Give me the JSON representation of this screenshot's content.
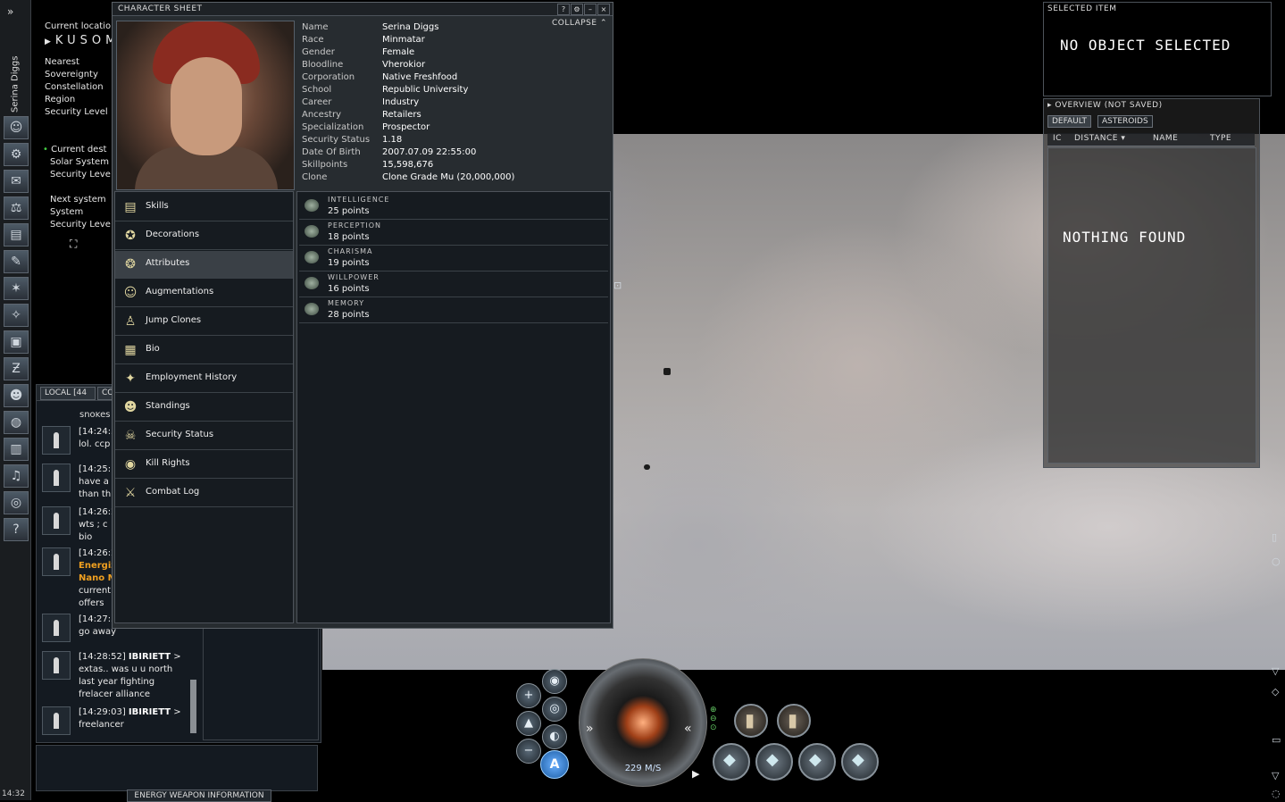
{
  "neocom": {
    "character_name": "Serina Diggs",
    "clock": "14:32",
    "expand_glyph": "»",
    "icons": [
      "portrait-icon",
      "assets-icon",
      "mail-icon",
      "market-icon",
      "wallet-icon",
      "journal-icon",
      "map-icon",
      "starmap-icon",
      "ship-icon",
      "scanner-icon",
      "people-icon",
      "world-icon",
      "notepad-icon",
      "audio-icon",
      "browser-icon",
      "help-icon"
    ]
  },
  "location": {
    "current_location_label": "Current locatio",
    "system_name": "KUSOM",
    "nearest_label": "Nearest",
    "sovereignty_label": "Sovereignty",
    "constellation_label": "Constellation",
    "region_label": "Region",
    "security_label": "Security Level",
    "current_dest_label": "Current dest",
    "solar_system_label": "Solar System",
    "security_label_2": "Security Leve",
    "next_system_label": "Next system",
    "system_label": "System",
    "security_label_3": "Security Leve"
  },
  "character_sheet": {
    "title": "CHARACTER SHEET",
    "collapse_label": "COLLAPSE",
    "controls": [
      "?",
      "⚙",
      "–",
      "×"
    ],
    "info": [
      {
        "key": "Name",
        "value": "Serina Diggs"
      },
      {
        "key": "Race",
        "value": "Minmatar"
      },
      {
        "key": "Gender",
        "value": "Female"
      },
      {
        "key": "Bloodline",
        "value": "Vherokior"
      },
      {
        "key": "Corporation",
        "value": "Native Freshfood"
      },
      {
        "key": "School",
        "value": "Republic University"
      },
      {
        "key": "Career",
        "value": "Industry"
      },
      {
        "key": "Ancestry",
        "value": "Retailers"
      },
      {
        "key": "Specialization",
        "value": "Prospector"
      },
      {
        "key": "Security Status",
        "value": "1.18"
      },
      {
        "key": "Date Of Birth",
        "value": "2007.07.09 22:55:00"
      },
      {
        "key": "Skillpoints",
        "value": "15,598,676"
      },
      {
        "key": "Clone",
        "value": "Clone Grade Mu (20,000,000)"
      }
    ],
    "nav": [
      {
        "label": "Skills",
        "icon": "book-icon"
      },
      {
        "label": "Decorations",
        "icon": "medal-icon"
      },
      {
        "label": "Attributes",
        "icon": "brain-icon",
        "selected": true
      },
      {
        "label": "Augmentations",
        "icon": "head-icon"
      },
      {
        "label": "Jump Clones",
        "icon": "clone-icon"
      },
      {
        "label": "Bio",
        "icon": "bio-icon"
      },
      {
        "label": "Employment History",
        "icon": "stars-icon"
      },
      {
        "label": "Standings",
        "icon": "people-icon"
      },
      {
        "label": "Security Status",
        "icon": "skull-icon"
      },
      {
        "label": "Kill Rights",
        "icon": "target-icon"
      },
      {
        "label": "Combat Log",
        "icon": "swords-icon"
      }
    ],
    "attributes": [
      {
        "name": "INTELLIGENCE",
        "points": "25 points"
      },
      {
        "name": "PERCEPTION",
        "points": "18 points"
      },
      {
        "name": "CHARISMA",
        "points": "19 points"
      },
      {
        "name": "WILLPOWER",
        "points": "16 points"
      },
      {
        "name": "MEMORY",
        "points": "28 points"
      }
    ]
  },
  "chat": {
    "tab_local": "LOCAL [44",
    "tab_corp": "CO",
    "partial_top": "snokes",
    "messages": [
      {
        "line1": "[14:24:3",
        "line2": "lol. ccp"
      },
      {
        "line1": "[14:25:1",
        "line2": "have a",
        "line3": "than th"
      },
      {
        "line1": "[14:26:2",
        "line2": "wts ; c",
        "line3": "bio"
      },
      {
        "line1": "[14:26:2",
        "line2": "Energiz",
        "line3": "Nano M",
        "line4": "current",
        "line5": "offers"
      },
      {
        "line1": "[14:27:3",
        "line2": "go away"
      },
      {
        "time": "[14:28:52]",
        "sender": "IBIRIETT",
        "line2": "extas.. was u u north",
        "line3": "last year fighting",
        "line4": "frelacer alliance"
      },
      {
        "time": "[14:29:03]",
        "sender": "IBIRIETT",
        "line2": "freelancer"
      }
    ],
    "energy_tab": "ENERGY WEAPON INFORMATION"
  },
  "selected_item": {
    "title": "SELECTED ITEM",
    "message": "NO OBJECT SELECTED"
  },
  "overview": {
    "title": "OVERVIEW (NOT SAVED)",
    "tabs": [
      "DEFAULT",
      "ASTEROIDS"
    ],
    "columns": [
      "IC",
      "DISTANCE",
      "NAME",
      "TYPE"
    ],
    "empty_message": "NOTHING FOUND"
  },
  "hud": {
    "speed": "229 M/S",
    "autopilot_label": "A"
  }
}
